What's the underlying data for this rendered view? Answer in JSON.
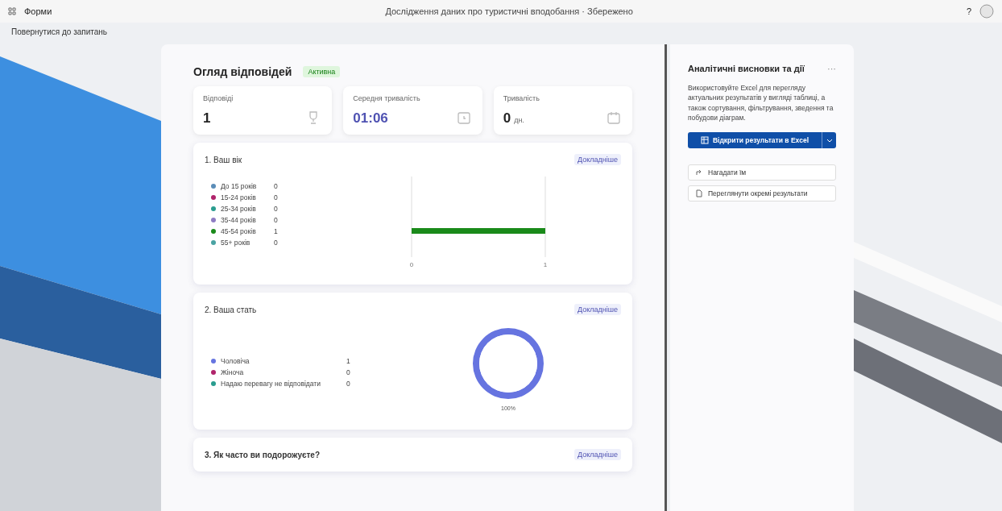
{
  "topbar": {
    "app_name": "Форми",
    "title": "Дослідження даних про туристичні вподобання · Збережено",
    "help": "?"
  },
  "back_link": "Повернутися до запитань",
  "overview": {
    "title": "Огляд відповідей",
    "status": "Активна",
    "stats": [
      {
        "label": "Відповіді",
        "value": "1",
        "kind": "responses",
        "accent": false
      },
      {
        "label": "Середня тривалість",
        "value": "01:06",
        "kind": "time",
        "accent": true
      },
      {
        "label": "Тривалість",
        "value": "0",
        "unit": "дн.",
        "kind": "duration",
        "accent": false
      }
    ]
  },
  "questions": [
    {
      "title": "1. Ваш вік",
      "link": "Докладніше",
      "kind": "bar",
      "legend": [
        {
          "label": "До 15 років",
          "count": "0",
          "color": "#5b8db8"
        },
        {
          "label": "15-24 років",
          "count": "0",
          "color": "#b0246b"
        },
        {
          "label": "25-34 років",
          "count": "0",
          "color": "#2a9d8f"
        },
        {
          "label": "35-44 років",
          "count": "0",
          "color": "#8e7cc3"
        },
        {
          "label": "45-54 років",
          "count": "1",
          "color": "#1a8a1a"
        },
        {
          "label": "55+ років",
          "count": "0",
          "color": "#4aa3a3"
        }
      ],
      "chart_data": {
        "type": "bar",
        "orientation": "horizontal",
        "values": [
          0,
          0,
          0,
          0,
          1,
          0
        ],
        "xlim": [
          0,
          1
        ],
        "xticks": [
          {
            "value": 0,
            "label": "0"
          },
          {
            "value": 1,
            "label": "1"
          }
        ]
      }
    },
    {
      "title": "2. Ваша стать",
      "link": "Докладніше",
      "kind": "donut",
      "legend": [
        {
          "count": "1",
          "color": "#6674e0"
        },
        {
          "count": "0",
          "color": "#b0246b"
        },
        {
          "count": "0",
          "color": "#2a9d8f"
        }
      ],
      "chart_data": {
        "type": "donut",
        "categories": [
          "Чоловіча",
          "Жіноча",
          "Надаю перевагу не відповідати"
        ],
        "values": [
          1,
          0,
          0
        ],
        "value_labels": [
          "100%",
          null,
          null
        ]
      }
    },
    {
      "title": "3. Як часто ви подорожуєте?",
      "link": "Докладніше",
      "kind": "collapsed"
    }
  ],
  "insights": {
    "title": "Аналітичні висновки та дії",
    "more": "···",
    "text": "Використовуйте Excel для перегляду актуальних результатів у вигляді таблиці, а також сортування, фільтрування, зведення та побудови діаграм.",
    "primary": "Відкрити результати в Excel",
    "actions": [
      {
        "label": "Нагадати їм",
        "kind": "share"
      },
      {
        "label": "Переглянути окремі результати",
        "kind": "review"
      }
    ]
  }
}
